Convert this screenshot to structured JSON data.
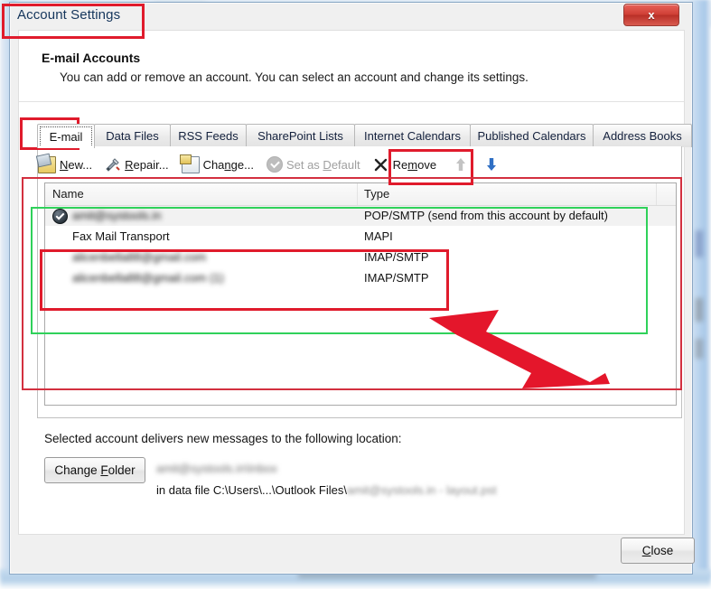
{
  "window": {
    "title": "Account Settings",
    "close_icon": "window-close-x",
    "close_glyph": "x"
  },
  "header": {
    "title": "E-mail Accounts",
    "subtitle": "You can add or remove an account. You can select an account and change its settings."
  },
  "tabs": [
    {
      "label": "E-mail",
      "active": true
    },
    {
      "label": "Data Files",
      "active": false
    },
    {
      "label": "RSS Feeds",
      "active": false
    },
    {
      "label": "SharePoint Lists",
      "active": false
    },
    {
      "label": "Internet Calendars",
      "active": false
    },
    {
      "label": "Published Calendars",
      "active": false
    },
    {
      "label": "Address Books",
      "active": false
    }
  ],
  "toolbar": {
    "new": {
      "label": "New...",
      "icon": "new-mail-icon",
      "disabled": false
    },
    "repair": {
      "label": "Repair...",
      "icon": "repair-tools-icon",
      "disabled": false
    },
    "change": {
      "label": "Change...",
      "icon": "change-account-icon",
      "disabled": false
    },
    "set_as_default": {
      "label": "Set as Default",
      "icon": "check-circle-icon",
      "disabled": true
    },
    "remove": {
      "label": "Remove",
      "icon": "remove-x-icon",
      "disabled": false
    },
    "move_up": {
      "icon": "arrow-up-icon",
      "disabled": true,
      "glyph": "⬆"
    },
    "move_down": {
      "icon": "arrow-down-icon",
      "disabled": false,
      "glyph": "⬇"
    }
  },
  "accounts_list": {
    "columns": [
      "Name",
      "Type"
    ],
    "rows": [
      {
        "name": "amit@systools.in",
        "type": "POP/SMTP (send from this account by default)",
        "default": true,
        "redacted": true,
        "selected": true
      },
      {
        "name": "Fax Mail Transport",
        "type": "MAPI",
        "default": false,
        "redacted": false,
        "selected": false
      },
      {
        "name": "alicenbella88@gmail.com",
        "type": "IMAP/SMTP",
        "default": false,
        "redacted": true,
        "selected": false
      },
      {
        "name": "alicenbella88@gmail.com (1)",
        "type": "IMAP/SMTP",
        "default": false,
        "redacted": true,
        "selected": false
      }
    ]
  },
  "delivery": {
    "label": "Selected account delivers new messages to the following location:",
    "change_folder_label": "Change Folder",
    "folder_path": "amit@systools.in\\Inbox",
    "datafile_prefix": "in data file C:\\Users\\...\\Outlook Files\\",
    "datafile_redacted": "amit@systools.in - layout.pst"
  },
  "footer": {
    "close_label": "Close"
  },
  "annotations": {
    "title_highlight": "red-rect-title",
    "email_tab_highlight": "red-rect-email-tab",
    "remove_highlight": "red-rect-remove",
    "list_outer_highlight": "red-rect-account-list",
    "list_inner_green_highlight": "green-rect-accounts",
    "imap_rows_highlight": "red-rect-imap-rows",
    "pointer": "red-arrow-pointer",
    "colors": {
      "red": "#e01b2c",
      "red_thin": "#d3303f",
      "green": "#2fd15a"
    }
  }
}
